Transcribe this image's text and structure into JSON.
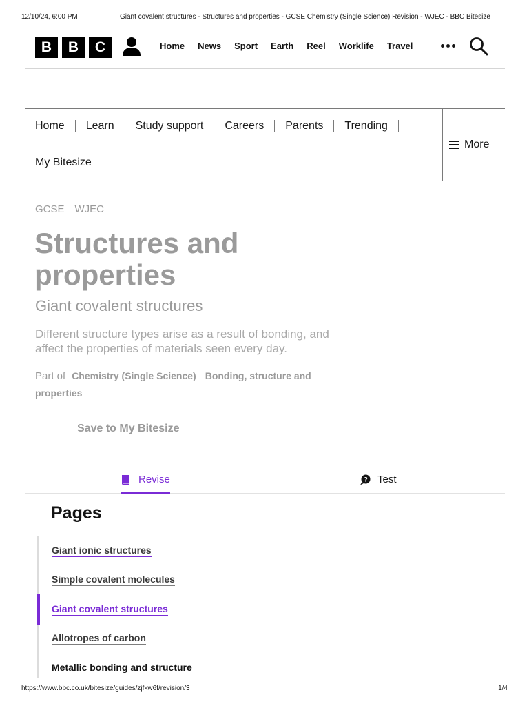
{
  "print_header": {
    "datetime": "12/10/24, 6:00 PM",
    "page_title": "Giant covalent structures - Structures and properties - GCSE Chemistry (Single Science) Revision - WJEC - BBC Bitesize"
  },
  "masthead": {
    "logo_letters": [
      "B",
      "B",
      "C"
    ],
    "nav": [
      "Home",
      "News",
      "Sport",
      "Earth",
      "Reel",
      "Worklife",
      "Travel"
    ],
    "icons": [
      "account-icon",
      "more-dots-icon",
      "search-icon"
    ]
  },
  "bitesize_nav": {
    "row1": [
      "Home",
      "Learn",
      "Study support",
      "Careers",
      "Parents",
      "Trending"
    ],
    "row2": [
      "My Bitesize"
    ],
    "more_label": "More"
  },
  "breadcrumbs": [
    "GCSE",
    "WJEC"
  ],
  "hero": {
    "title": "Structures and properties",
    "subtitle": "Giant covalent structures",
    "description": "Different structure types arise as a result of bonding, and affect the properties of materials seen every day.",
    "part_of_label": "Part of",
    "part_of_links": [
      "Chemistry (Single Science)",
      "Bonding, structure and properties"
    ],
    "save_label": "Save to My Bitesize"
  },
  "tabs": [
    {
      "label": "Revise",
      "icon": "book-icon",
      "active": true
    },
    {
      "label": "Test",
      "icon": "question-bubble-icon",
      "active": false
    }
  ],
  "pages": {
    "heading": "Pages",
    "items": [
      {
        "label": "Giant ionic structures"
      },
      {
        "label": "Simple covalent molecules"
      },
      {
        "label": "Giant covalent structures",
        "current": true
      },
      {
        "label": "Allotropes of carbon"
      },
      {
        "label": "Metallic bonding and structure"
      }
    ]
  },
  "print_footer": {
    "url": "https://www.bbc.co.uk/bitesize/guides/zjfkw6f/revision/3",
    "page_count": "1/4"
  },
  "colors": {
    "accent_purple": "#7a2bd6",
    "muted_text": "#9a9a9a",
    "black": "#000000"
  }
}
